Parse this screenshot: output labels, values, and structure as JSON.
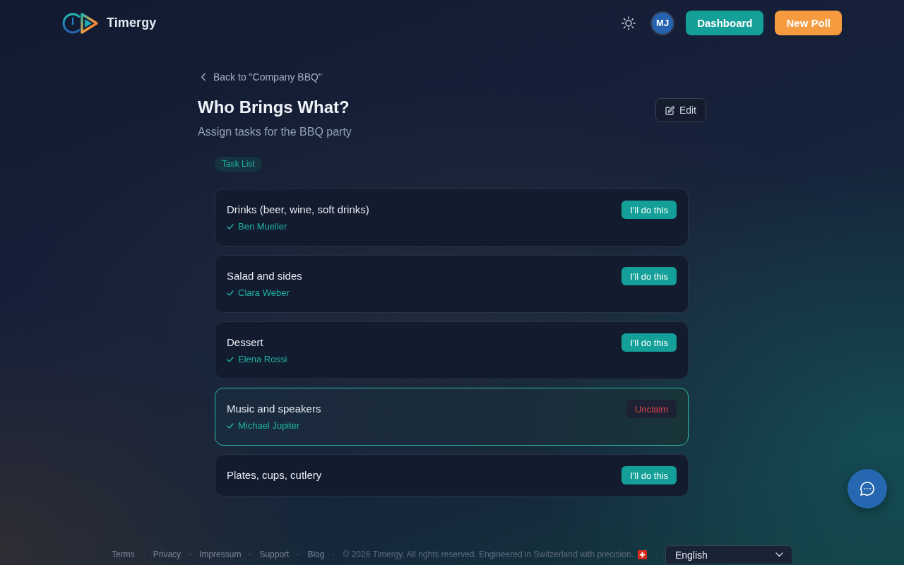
{
  "header": {
    "brand": "Timergy",
    "avatar_initials": "MJ",
    "buttons": [
      {
        "label": "Dashboard",
        "kind": "primary"
      },
      {
        "label": "New Poll",
        "kind": "accent"
      }
    ]
  },
  "page": {
    "back_link": "Back to \"Company BBQ\"",
    "title": "Who Brings What?",
    "subtitle": "Assign tasks for the BBQ party",
    "edit_button": "Edit",
    "badge": "Task List"
  },
  "tasks": [
    {
      "title": "Drinks (beer, wine, soft drinks)",
      "assignee": "Ben Mueller",
      "mine": false,
      "action": {
        "label": "I'll do this",
        "kind": "claim"
      }
    },
    {
      "title": "Salad and sides",
      "assignee": "Clara Weber",
      "mine": false,
      "action": {
        "label": "I'll do this",
        "kind": "claim"
      }
    },
    {
      "title": "Dessert",
      "assignee": "Elena Rossi",
      "mine": false,
      "action": {
        "label": "I'll do this",
        "kind": "claim"
      }
    },
    {
      "title": "Music and speakers",
      "assignee": "Michael Jupiter",
      "mine": true,
      "action": {
        "label": "Unclaim",
        "kind": "unclaim"
      }
    },
    {
      "title": "Plates, cups, cutlery",
      "mine": false,
      "action": {
        "label": "I'll do this",
        "kind": "claim"
      }
    }
  ],
  "footer": {
    "links": [
      "Terms",
      "Privacy",
      "Impressum",
      "Support",
      "Blog"
    ],
    "copyright": "© 2026 Timergy. All rights reserved. Engineered in Switzerland with precision.",
    "language": "English"
  }
}
